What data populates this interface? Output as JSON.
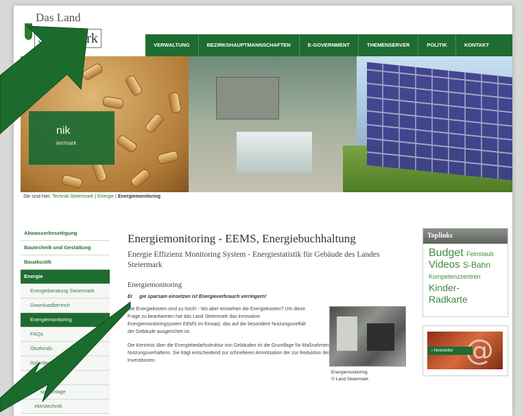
{
  "logo": {
    "line1": "Das Land",
    "line2": "Steiermark"
  },
  "nav": [
    "VERWALTUNG",
    "BEZIRKSHAUPTMANNSCHAFTEN",
    "E-GOVERNMENT",
    "THEMENSERVER",
    "POLITIK",
    "KONTAKT"
  ],
  "banner": {
    "title_fragment": "nik",
    "subtitle_fragment": "ierrmark"
  },
  "breadcrumb": {
    "prefix": "Sie sind hier:",
    "items": [
      "Technik-Steiermark",
      "Energie"
    ],
    "separator": "|",
    "current": "Energiemonitoring"
  },
  "sidebar": [
    {
      "label": "Abwasserbeseitigung"
    },
    {
      "label": "Bautechnik und Gestaltung"
    },
    {
      "label": "Bauakustik"
    },
    {
      "label": "Energie"
    },
    {
      "label": "Energieberatung Steiermark"
    },
    {
      "label": "Downloadbereich"
    },
    {
      "label": "Energiemonitoring"
    },
    {
      "label": "FAQs"
    },
    {
      "label": "Ökofonds"
    },
    {
      "label": "Solardac        ermark"
    },
    {
      "label": "       ngen"
    },
    {
      "label": "       sprechtage"
    },
    {
      "label": "   ektrotechnik"
    },
    {
      "label": "W"
    }
  ],
  "main": {
    "title": "Energiemonitoring - EEMS, Energiebuchhaltung",
    "subtitle": "Energie Effizienz Monitoring System - Energiestatistik für Gebäude des Landes Steiermark",
    "section": "Energiemonitoring",
    "lead": "Er     gie sparsam einsetzen ist Energieverbrauch verringern!",
    "para1": "Die Energiekosten sind zu hoch! - Wo aber entstehen die Energiekosten? Um diese Frage zu beantworten hat das Land Steiermark das innovative Energiemonitoringsystem EEMS im Einsatz, das auf die besondere Nutzungsvielfalt der Gebäude ausgerichtet ist.",
    "para2": "Die Kenntnis über die Energiebedarfsstruktur von Gebäuden ist die Grundlage für Maßnahmen zur Änderung des Nutzungsverhaltens. Sie trägt entscheidend zur schnelleren Amortisation der zur Reduktion des Energieverbrauches getroffenen Investitionen.",
    "photo_caption_1": "Energiemonitoring",
    "photo_caption_2": "© Land Steiermark"
  },
  "toplinks": {
    "header": "Toplinks",
    "tags": [
      "Budget",
      "Feinstaub",
      "Videos",
      "S-Bahn",
      "Kompetenzzentren",
      "Kinder-",
      "Radkarte"
    ]
  },
  "newsletter": {
    "label": "› Newsletter"
  },
  "colors": {
    "primary_green": "#1e6c31",
    "arrow_green": "#1b6b2c"
  }
}
